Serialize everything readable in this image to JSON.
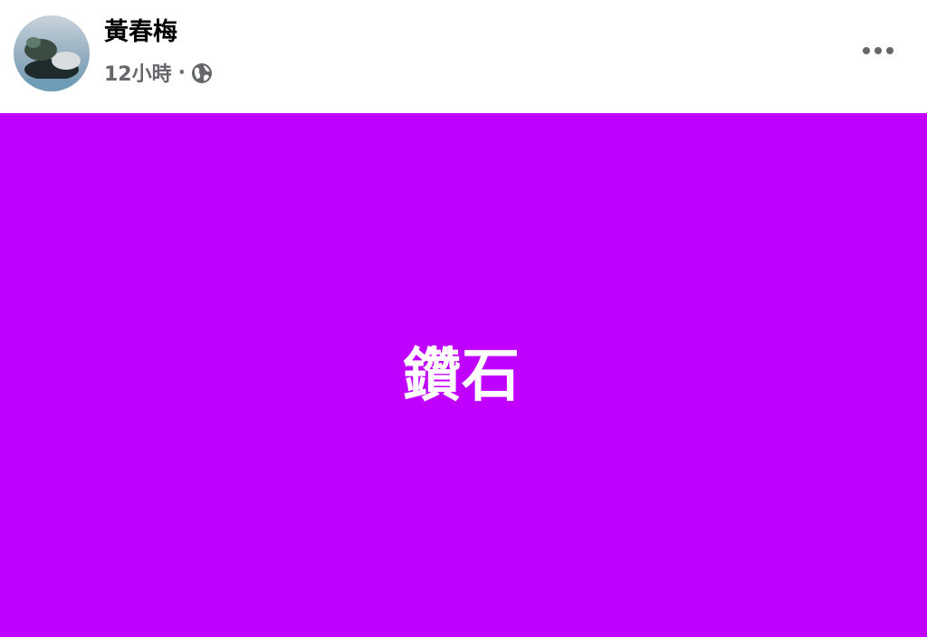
{
  "post": {
    "author_name": "黃春梅",
    "timestamp": "12小時",
    "separator": "·",
    "privacy_icon": "globe-icon",
    "more_icon": "more-options-icon",
    "body_text": "鑽石",
    "body_background": "#c000ff",
    "text_color": "#ffffff"
  }
}
